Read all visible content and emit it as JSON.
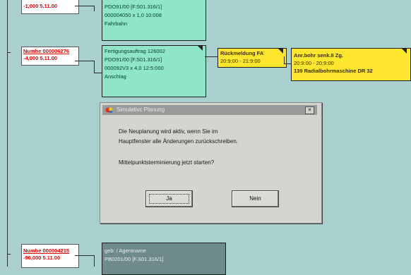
{
  "orders": [
    {
      "number": "",
      "quantity": "-1,000  5.11.00"
    },
    {
      "number": "Numbe 000006276",
      "quantity": "-4,000  5.11.00"
    },
    {
      "number": "Numbe 000004215",
      "quantity": "-96,000  5.11.00"
    }
  ],
  "operation_cards": [
    {
      "lines": [
        "PDO91/00 [F.S01.316/1]",
        "000004050 x 1,0 10:008",
        "Fahrbahn"
      ]
    },
    {
      "lines": [
        "Fertigungsauftrag 126002",
        "PDO91/00 [F.S01.316/1]",
        "000092V3 x 4,0 12:5:000",
        "Anschlag"
      ]
    },
    {
      "lines": [
        "geb: / Agentname",
        "PB0201/00 [F.S01.316/1]"
      ]
    }
  ],
  "feedback_card": {
    "title": "Rückmeldung FA",
    "times": "20:9:00 - 21:9:00"
  },
  "work_card": {
    "lines": [
      "Anr.bohr senk.8 Zg.",
      "20:9:00 - 20:9:00",
      "139 Radialbohrmaschine DR 32"
    ]
  },
  "dialog": {
    "title": "Simulativc Planung",
    "close_glyph": "✕",
    "message_line1": "Die Neuplanung wird aktiv, wenn Sie im",
    "message_line2": "Hauptfenster alle Änderungen zurückschreiben.",
    "message_line3": "Mittelpunktsterminierung jetzt starten?",
    "yes_label": "Ja",
    "no_label": "Nein"
  },
  "colors": {
    "background": "#a9cfcf",
    "operation": "#8fe6c7",
    "highlight": "#ffe62e",
    "order_number": "#e00000"
  }
}
